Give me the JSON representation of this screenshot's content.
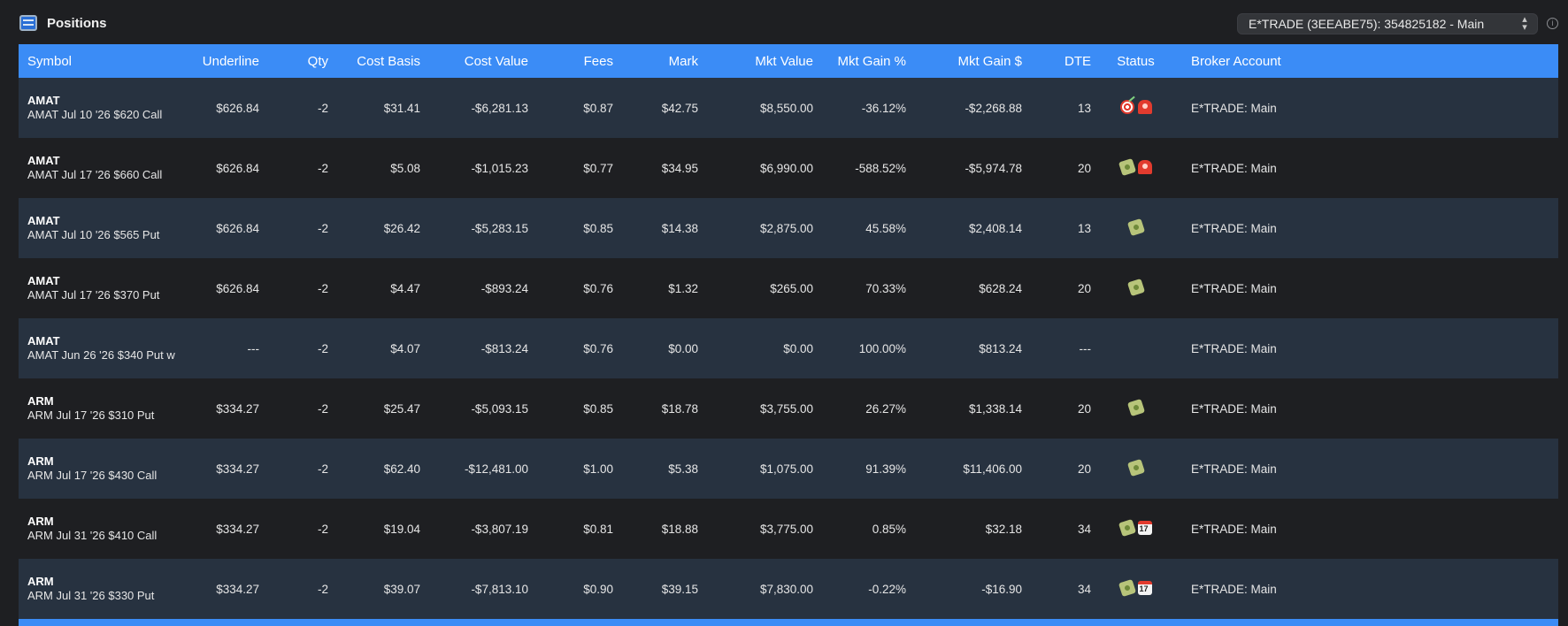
{
  "window": {
    "title": "Positions",
    "account_selector": "E*TRADE (3EEABE75): 354825182 - Main",
    "info_icon": "info-icon",
    "app_icon": "wallet-icon"
  },
  "table": {
    "columns": {
      "symbol": "Symbol",
      "underline": "Underline",
      "qty": "Qty",
      "cost_basis": "Cost Basis",
      "cost_value": "Cost Value",
      "fees": "Fees",
      "mark": "Mark",
      "mkt_value": "Mkt Value",
      "mkt_gain_pct": "Mkt Gain %",
      "mkt_gain_usd": "Mkt Gain $",
      "dte": "DTE",
      "status": "Status",
      "broker_account": "Broker Account"
    },
    "rows": [
      {
        "symbol": "AMAT",
        "desc": "AMAT Jul 10 '26 $620 Call",
        "underline": "$626.84",
        "qty": "-2",
        "cost_basis": "$31.41",
        "cost_value": "-$6,281.13",
        "fees": "$0.87",
        "mark": "$42.75",
        "mkt_value": "$8,550.00",
        "gain_pct": "-36.12%",
        "gain_usd": "-$2,268.88",
        "gain_sign": "neg",
        "dte": "13",
        "status": [
          "dart",
          "alarm"
        ],
        "broker": "E*TRADE: Main"
      },
      {
        "symbol": "AMAT",
        "desc": "AMAT Jul 17 '26 $660 Call",
        "underline": "$626.84",
        "qty": "-2",
        "cost_basis": "$5.08",
        "cost_value": "-$1,015.23",
        "fees": "$0.77",
        "mark": "$34.95",
        "mkt_value": "$6,990.00",
        "gain_pct": "-588.52%",
        "gain_usd": "-$5,974.78",
        "gain_sign": "neg",
        "dte": "20",
        "status": [
          "money",
          "alarm"
        ],
        "broker": "E*TRADE: Main"
      },
      {
        "symbol": "AMAT",
        "desc": "AMAT Jul 10 '26 $565 Put",
        "underline": "$626.84",
        "qty": "-2",
        "cost_basis": "$26.42",
        "cost_value": "-$5,283.15",
        "fees": "$0.85",
        "mark": "$14.38",
        "mkt_value": "$2,875.00",
        "gain_pct": "45.58%",
        "gain_usd": "$2,408.14",
        "gain_sign": "pos",
        "dte": "13",
        "status": [
          "money"
        ],
        "broker": "E*TRADE: Main"
      },
      {
        "symbol": "AMAT",
        "desc": "AMAT Jul 17 '26 $370 Put",
        "underline": "$626.84",
        "qty": "-2",
        "cost_basis": "$4.47",
        "cost_value": "-$893.24",
        "fees": "$0.76",
        "mark": "$1.32",
        "mkt_value": "$265.00",
        "gain_pct": "70.33%",
        "gain_usd": "$628.24",
        "gain_sign": "pos",
        "dte": "20",
        "status": [
          "money"
        ],
        "broker": "E*TRADE: Main"
      },
      {
        "symbol": "AMAT",
        "desc": "AMAT Jun 26 '26 $340 Put w",
        "underline": "---",
        "qty": "-2",
        "cost_basis": "$4.07",
        "cost_value": "-$813.24",
        "fees": "$0.76",
        "mark": "$0.00",
        "mkt_value": "$0.00",
        "gain_pct": "100.00%",
        "gain_usd": "$813.24",
        "gain_sign": "pos",
        "dte": "---",
        "status": [],
        "broker": "E*TRADE: Main"
      },
      {
        "symbol": "ARM",
        "desc": "ARM Jul 17 '26 $310 Put",
        "underline": "$334.27",
        "qty": "-2",
        "cost_basis": "$25.47",
        "cost_value": "-$5,093.15",
        "fees": "$0.85",
        "mark": "$18.78",
        "mkt_value": "$3,755.00",
        "gain_pct": "26.27%",
        "gain_usd": "$1,338.14",
        "gain_sign": "pos",
        "dte": "20",
        "status": [
          "money"
        ],
        "broker": "E*TRADE: Main"
      },
      {
        "symbol": "ARM",
        "desc": "ARM Jul 17 '26 $430 Call",
        "underline": "$334.27",
        "qty": "-2",
        "cost_basis": "$62.40",
        "cost_value": "-$12,481.00",
        "fees": "$1.00",
        "mark": "$5.38",
        "mkt_value": "$1,075.00",
        "gain_pct": "91.39%",
        "gain_usd": "$11,406.00",
        "gain_sign": "pos",
        "dte": "20",
        "status": [
          "money"
        ],
        "broker": "E*TRADE: Main"
      },
      {
        "symbol": "ARM",
        "desc": "ARM Jul 31 '26 $410 Call",
        "underline": "$334.27",
        "qty": "-2",
        "cost_basis": "$19.04",
        "cost_value": "-$3,807.19",
        "fees": "$0.81",
        "mark": "$18.88",
        "mkt_value": "$3,775.00",
        "gain_pct": "0.85%",
        "gain_usd": "$32.18",
        "gain_sign": "pos",
        "dte": "34",
        "status": [
          "money",
          "calendar"
        ],
        "broker": "E*TRADE: Main"
      },
      {
        "symbol": "ARM",
        "desc": "ARM Jul 31 '26 $330 Put",
        "underline": "$334.27",
        "qty": "-2",
        "cost_basis": "$39.07",
        "cost_value": "-$7,813.10",
        "fees": "$0.90",
        "mark": "$39.15",
        "mkt_value": "$7,830.00",
        "gain_pct": "-0.22%",
        "gain_usd": "-$16.90",
        "gain_sign": "neg",
        "dte": "34",
        "status": [
          "money",
          "calendar"
        ],
        "broker": "E*TRADE: Main"
      }
    ]
  },
  "colors": {
    "header_blue": "#3b8cf6",
    "negative": "#f0524f",
    "positive": "#52c56b",
    "row_alt": "#273240",
    "background": "#1e1f22"
  }
}
